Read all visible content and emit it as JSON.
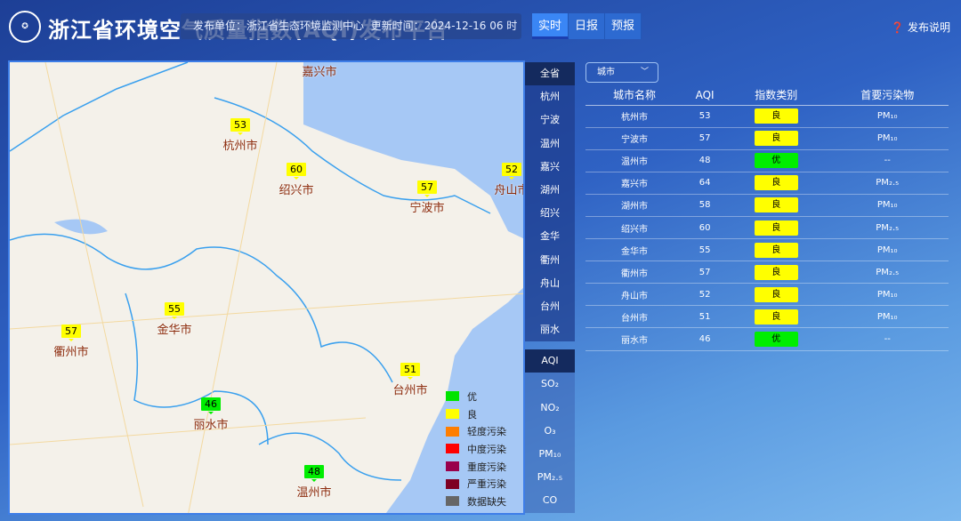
{
  "header": {
    "title": "浙江省环境空气质量指数(AQI)发布平台",
    "publisher": "发布单位：浙江省生态环境监测中心",
    "update_time": "更新时间：2024-12-16 06 时",
    "tabs": [
      "实时",
      "日报",
      "预报"
    ],
    "active_tab": "实时",
    "help": "发布说明",
    "logo_icon": "emblem-icon"
  },
  "colors": {
    "good": "#ffff00",
    "excellent": "#00ee00"
  },
  "map": {
    "markers": [
      {
        "city": "杭州市",
        "aqi": "53",
        "level": "good"
      },
      {
        "city": "绍兴市",
        "aqi": "60",
        "level": "good"
      },
      {
        "city": "宁波市",
        "aqi": "57",
        "level": "good"
      },
      {
        "city": "舟山市",
        "aqi": "52",
        "level": "good"
      },
      {
        "city": "金华市",
        "aqi": "55",
        "level": "good"
      },
      {
        "city": "衢州市",
        "aqi": "57",
        "level": "good"
      },
      {
        "city": "台州市",
        "aqi": "51",
        "level": "good"
      },
      {
        "city": "丽水市",
        "aqi": "46",
        "level": "excellent"
      },
      {
        "city": "温州市",
        "aqi": "48",
        "level": "excellent"
      }
    ],
    "extra_label": "嘉兴市",
    "legend": [
      {
        "label": "优",
        "color": "#00e400"
      },
      {
        "label": "良",
        "color": "#ffff00"
      },
      {
        "label": "轻度污染",
        "color": "#ff7e00"
      },
      {
        "label": "中度污染",
        "color": "#ff0000"
      },
      {
        "label": "重度污染",
        "color": "#99004c"
      },
      {
        "label": "严重污染",
        "color": "#7e0023"
      },
      {
        "label": "数据缺失",
        "color": "#666666"
      }
    ]
  },
  "side_cities": [
    "全省",
    "杭州",
    "宁波",
    "温州",
    "嘉兴",
    "湖州",
    "绍兴",
    "金华",
    "衢州",
    "舟山",
    "台州",
    "丽水"
  ],
  "side_pollutants": [
    "AQI",
    "SO₂",
    "NO₂",
    "O₃",
    "PM₁₀",
    "PM₂.₅",
    "CO"
  ],
  "table": {
    "select": "城市",
    "headers": [
      "城市名称",
      "AQI",
      "指数类别",
      "首要污染物"
    ],
    "rows": [
      [
        "杭州市",
        "53",
        "良",
        "PM₁₀"
      ],
      [
        "宁波市",
        "57",
        "良",
        "PM₁₀"
      ],
      [
        "温州市",
        "48",
        "优",
        "--"
      ],
      [
        "嘉兴市",
        "64",
        "良",
        "PM₂.₅"
      ],
      [
        "湖州市",
        "58",
        "良",
        "PM₁₀"
      ],
      [
        "绍兴市",
        "60",
        "良",
        "PM₂.₅"
      ],
      [
        "金华市",
        "55",
        "良",
        "PM₁₀"
      ],
      [
        "衢州市",
        "57",
        "良",
        "PM₂.₅"
      ],
      [
        "舟山市",
        "52",
        "良",
        "PM₁₀"
      ],
      [
        "台州市",
        "51",
        "良",
        "PM₁₀"
      ],
      [
        "丽水市",
        "46",
        "优",
        "--"
      ]
    ]
  }
}
